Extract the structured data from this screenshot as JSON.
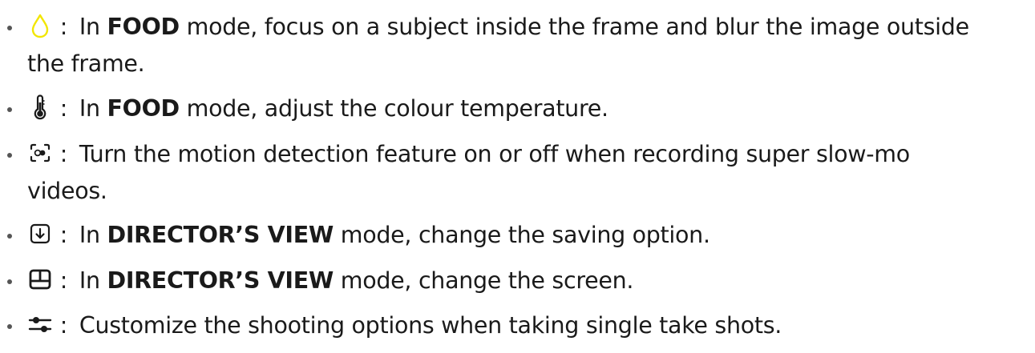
{
  "items": [
    {
      "icon": "drop-shape-icon",
      "sep": ":",
      "pre": "In",
      "mode": "FOOD",
      "rest": "mode, focus on a subject inside the frame and blur the image outside",
      "cont": "the frame."
    },
    {
      "icon": "thermometer-icon",
      "sep": ":",
      "pre": "In",
      "mode": "FOOD",
      "rest": "mode, adjust the colour temperature."
    },
    {
      "icon": "motion-detection-icon",
      "sep": ":",
      "text": "Turn the motion detection feature on or off when recording super slow-mo",
      "cont": "videos."
    },
    {
      "icon": "save-download-icon",
      "sep": ":",
      "pre": "In",
      "mode": "DIRECTOR’S VIEW",
      "rest": "mode, change the saving option."
    },
    {
      "icon": "screen-layout-icon",
      "sep": ":",
      "pre": "In",
      "mode": "DIRECTOR’S VIEW",
      "rest": "mode, change the screen."
    },
    {
      "icon": "sliders-icon",
      "sep": ":",
      "text": "Customize the shooting options when taking single take shots."
    }
  ],
  "colors": {
    "text": "#1a1a1a",
    "bullet": "#555555",
    "drop_icon": "#f2e600"
  }
}
